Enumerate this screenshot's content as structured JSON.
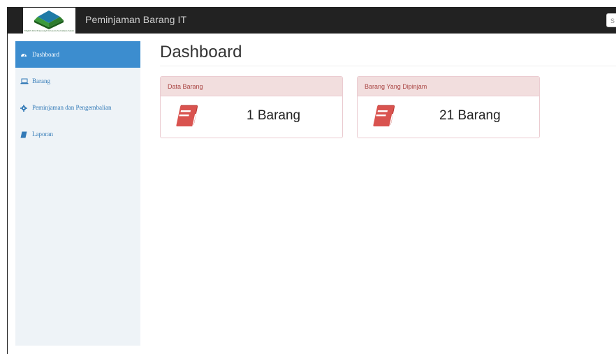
{
  "navbar": {
    "brand": "Peminjaman Barang IT",
    "logo_text": "MAJLIS Dzx Praasnayt Kmasnis Sumatera Selatan",
    "search_placeholder": "S"
  },
  "sidebar": {
    "items": [
      {
        "label": "Dashboard",
        "icon": "dashboard-icon",
        "active": true
      },
      {
        "label": "Barang",
        "icon": "laptop-icon",
        "active": false
      },
      {
        "label": "Peminjaman dan Pengembalian",
        "icon": "gear-icon",
        "active": false
      },
      {
        "label": "Laporan",
        "icon": "book-icon",
        "active": false
      }
    ]
  },
  "main": {
    "title": "Dashboard",
    "panels": [
      {
        "heading": "Data Barang",
        "value": "1 Barang",
        "icon": "book-icon"
      },
      {
        "heading": "Barang Yang Dipinjam",
        "value": "21 Barang",
        "icon": "book-icon"
      }
    ]
  },
  "colors": {
    "navbar_bg": "#222222",
    "sidebar_bg": "#eef3f7",
    "active_item": "#3c8dcf",
    "panel_heading_bg": "#f2dede",
    "panel_heading_text": "#a94442",
    "book_icon": "#d9534f"
  }
}
